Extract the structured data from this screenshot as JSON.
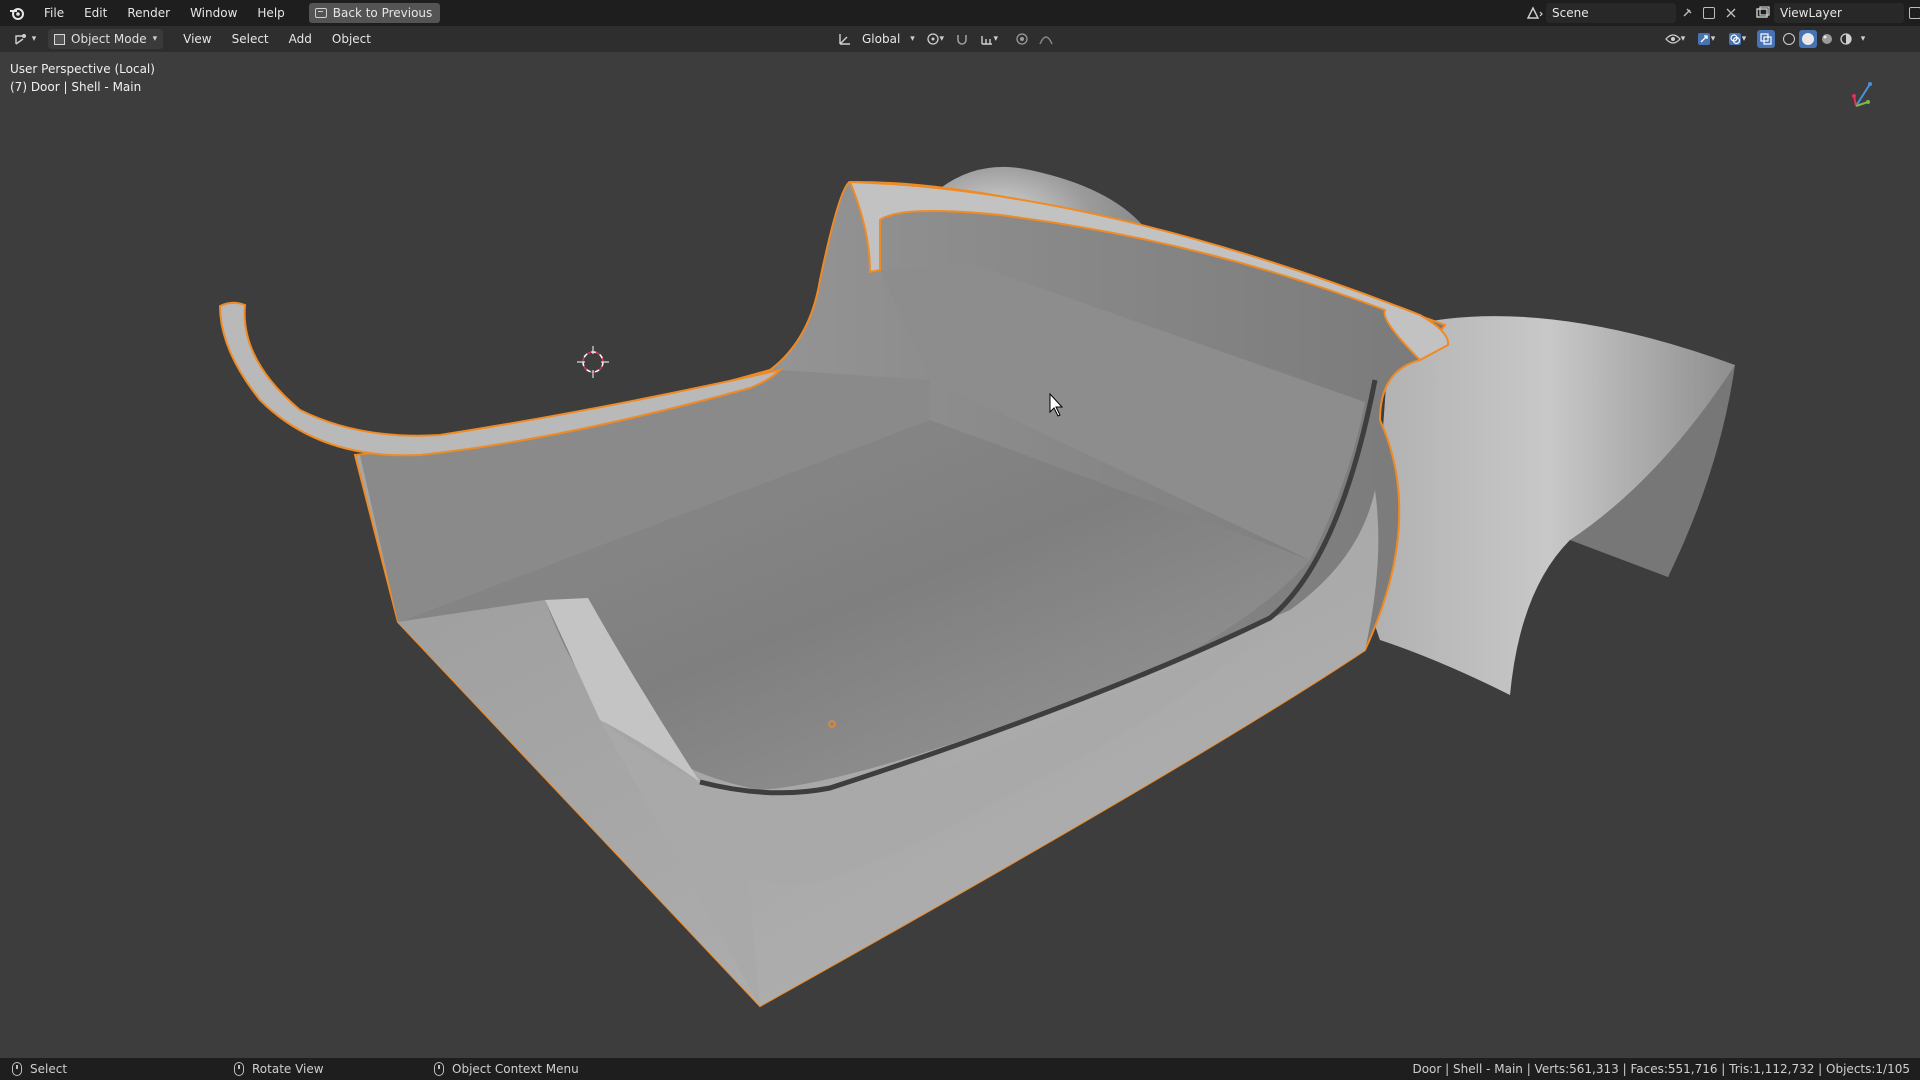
{
  "topbar": {
    "menu": [
      "File",
      "Edit",
      "Render",
      "Window",
      "Help"
    ],
    "back_button": "Back to Previous",
    "scene_name": "Scene",
    "view_layer": "ViewLayer"
  },
  "viewport_header": {
    "mode": "Object Mode",
    "menu": [
      "View",
      "Select",
      "Add",
      "Object"
    ],
    "transform_orientation": "Global"
  },
  "viewport": {
    "perspective_label": "User Perspective (Local)",
    "object_label": "(7) Door | Shell - Main"
  },
  "statusbar": {
    "select": "Select",
    "rotate": "Rotate View",
    "context_menu": "Object Context Menu",
    "stats": "Door | Shell - Main | Verts:561,313 | Faces:551,716 | Tris:1,112,732 | Objects:1/105"
  },
  "colors": {
    "selection_outline": "#f08a24",
    "viewport_bg": "#3d3d3d",
    "header_bg": "#2e2e2e",
    "topbar_bg": "#1e1e1e",
    "active_button": "#4772b3"
  }
}
